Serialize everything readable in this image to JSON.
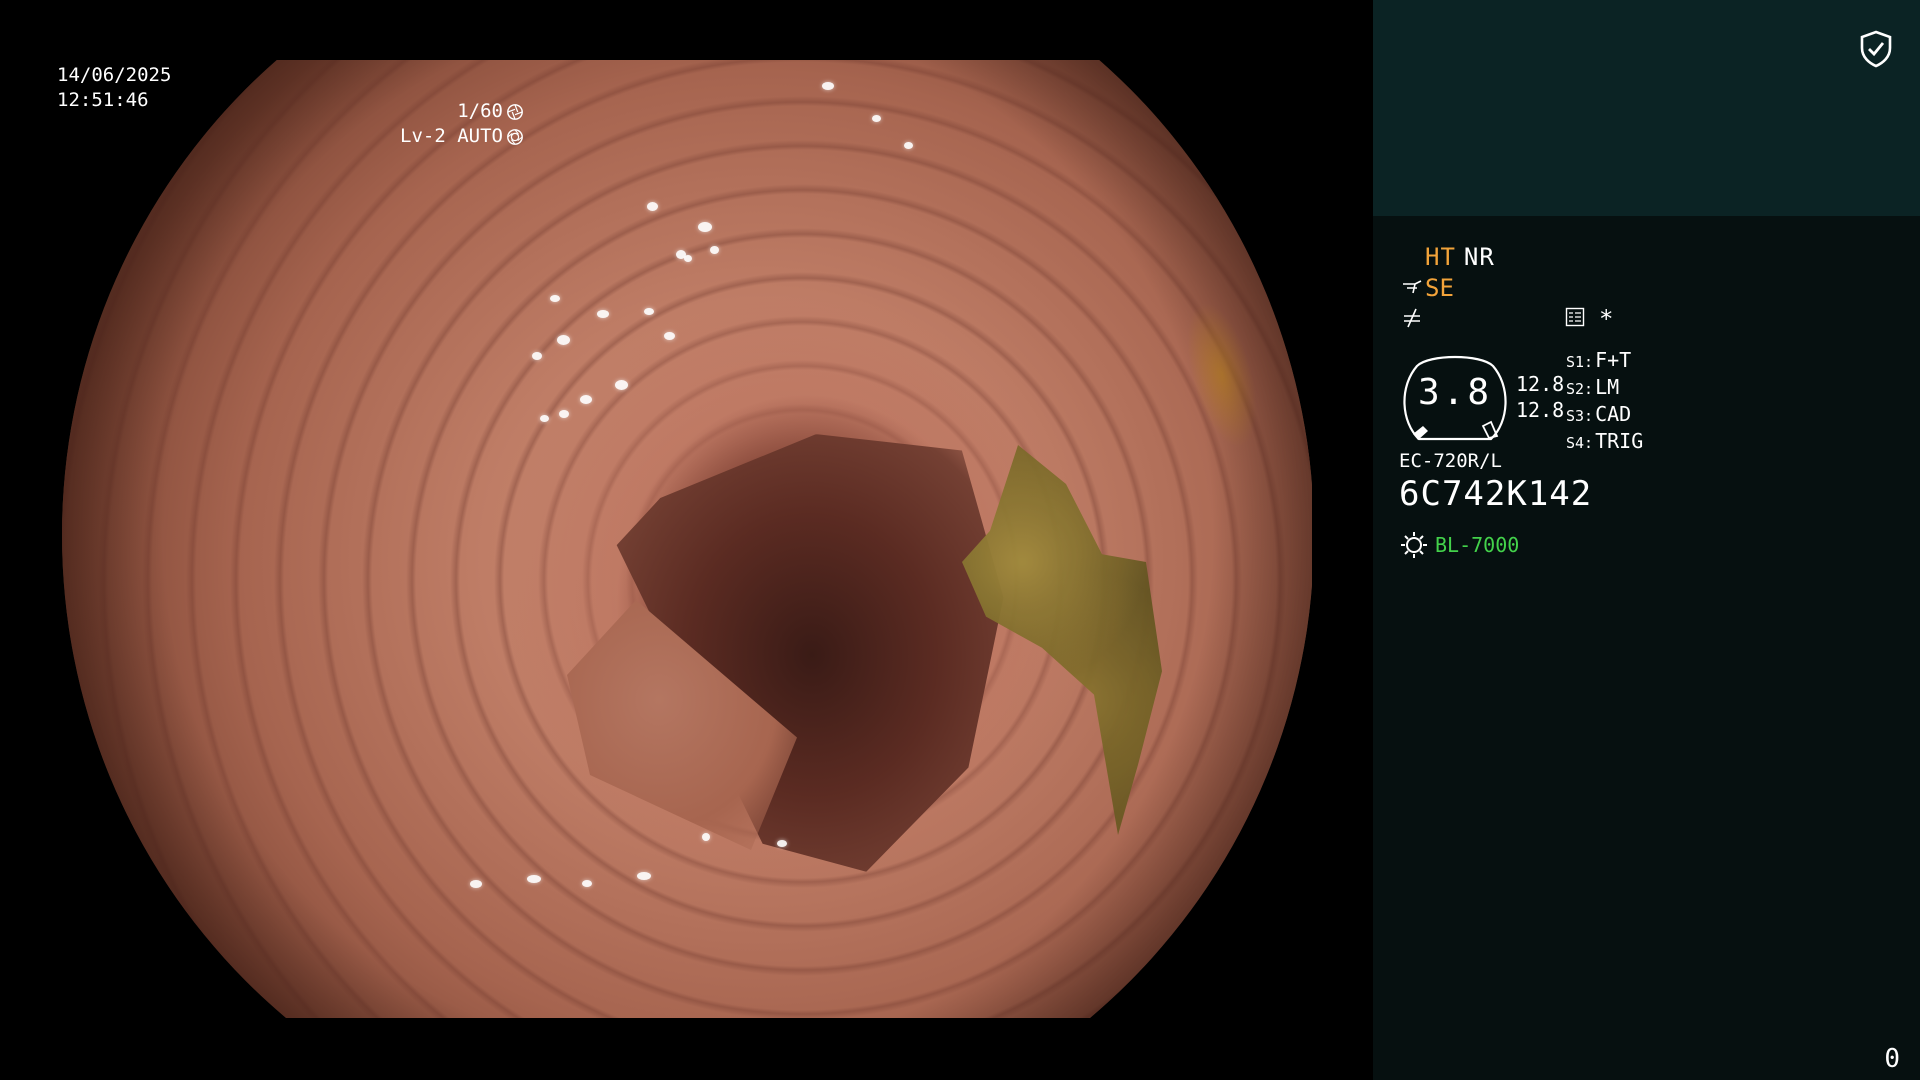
{
  "overlay": {
    "date": "14/06/2025",
    "time": "12:51:46",
    "shutter": "1/60",
    "brightness": "Lv-2 AUTO"
  },
  "panel": {
    "modes": {
      "ht": "HT",
      "nr": "NR"
    },
    "se_label": "SE",
    "star": "*",
    "zoom": "3.8",
    "values": [
      "12.8",
      "12.8"
    ],
    "switches": [
      {
        "key": "S1:",
        "value": "F+T"
      },
      {
        "key": "S2:",
        "value": "LM"
      },
      {
        "key": "S3:",
        "value": "CAD"
      },
      {
        "key": "S4:",
        "value": "TRIG"
      }
    ],
    "scope_model": "EC-720R/L",
    "scope_serial": "6C742K142",
    "light_source": "BL-7000",
    "counter": "0"
  },
  "colors": {
    "panel_bg": "#061010",
    "panel_top_bg": "#0b2324",
    "accent_orange": "#f2a33a",
    "accent_green": "#43d24b",
    "text": "#ffffff"
  },
  "icons": [
    "shield-check-icon",
    "shutter-icon",
    "iris-icon",
    "scope-tip-icon",
    "structure-enhance-icon",
    "settings-list-icon",
    "light-source-icon"
  ]
}
